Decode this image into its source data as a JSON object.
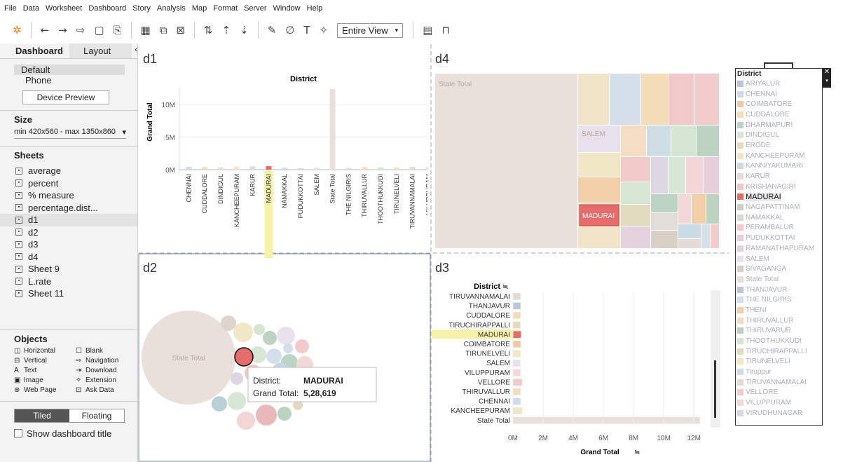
{
  "menu": [
    "File",
    "Data",
    "Worksheet",
    "Dashboard",
    "Story",
    "Analysis",
    "Map",
    "Format",
    "Server",
    "Window",
    "Help"
  ],
  "toolbar": {
    "view_select": "Entire View"
  },
  "left_pane": {
    "tabs": [
      "Dashboard",
      "Layout"
    ],
    "devices": [
      "Default",
      "Phone"
    ],
    "device_preview": "Device Preview",
    "size_title": "Size",
    "size_value": "min 420x560 - max 1350x860",
    "sheets_title": "Sheets",
    "sheets": [
      "average",
      "percent",
      "% measure",
      "percentage.dist...",
      "d1",
      "d2",
      "d3",
      "d4",
      "Sheet 9",
      "L.rate",
      "Sheet 11"
    ],
    "objects_title": "Objects",
    "objects": [
      "Horizontal",
      "Blank",
      "Vertical",
      "Navigation",
      "Text",
      "Download",
      "Image",
      "Extension",
      "Web Page",
      "Ask Data"
    ],
    "tiled": "Tiled",
    "floating": "Floating",
    "show_title": "Show dashboard title"
  },
  "d1": {
    "title": "d1",
    "chart_title": "District",
    "ylabel": "Grand Total",
    "yticks": [
      "10M",
      "5M",
      "0M"
    ]
  },
  "d2": {
    "title": "d2",
    "state_label": "State Total",
    "tooltip_district_label": "District:",
    "tooltip_district_value": "MADURAI",
    "tooltip_total_label": "Grand Total:",
    "tooltip_total_value": "5,28,619"
  },
  "d3": {
    "title": "d3",
    "header": "District",
    "xlabel": "Grand Total",
    "xticks": [
      "0M",
      "2M",
      "4M",
      "6M",
      "8M",
      "10M",
      "12M"
    ]
  },
  "d4": {
    "title": "d4",
    "state_label": "State Total",
    "salem_label": "SALEM",
    "madurai_label": "MADURAI"
  },
  "legend": {
    "title": "District",
    "items": [
      "ARIYALUR",
      "CHENNAI",
      "COIMBATORE",
      "CUDDALORE",
      "DHARMAPURI",
      "DINDIGUL",
      "ERODE",
      "KANCHEEPURAM",
      "KANNIYAKUMARI",
      "KARUR",
      "KRISHANAGIRI",
      "MADURAI",
      "NAGAPATTINAM",
      "NAMAKKAL",
      "PERAMBALUR",
      "PUDUKKOTTAI",
      "RAMANATHAPURAM",
      "SALEM",
      "SIVAGANGA",
      "State Total",
      "THANJAVUR",
      "THE NILGIRIS",
      "THENI",
      "THIRUVALLUR",
      "THIRUVARUR",
      "THOOTHUKKUDI",
      "TIRUCHIRAPPALLI",
      "TIRUNELVELI",
      "Tiruppur",
      "TIRUVANNAMALAI",
      "VELLORE",
      "VILUPPURAM",
      "VIRUDHUNAGAR"
    ],
    "colors": [
      "#b9c7d6",
      "#cfdbe8",
      "#f2c7a6",
      "#f4dcb8",
      "#bcd4c4",
      "#d7e6d5",
      "#e6dcc0",
      "#f2e4c8",
      "#cbdbe3",
      "#e2ddd9",
      "#f1c9c9",
      "#e66b6b",
      "#cbd1c9",
      "#d9d9d9",
      "#f5c9c9",
      "#e6cfd8",
      "#e4d2de",
      "#e8e0ea",
      "#d8cfc5",
      "#eae0db",
      "#b8c8d8",
      "#d5dfe9",
      "#f3cfa9",
      "#f4ddc2",
      "#bcd3c1",
      "#d6e5d3",
      "#e3dbbf",
      "#f1e6c6",
      "#cfdde4",
      "#e3dcd4",
      "#f2cccc",
      "#f4d8d8",
      "#ddd6e3"
    ],
    "highlight": "MADURAI"
  },
  "chart_data": [
    {
      "type": "bar",
      "title": "District",
      "ylabel": "Grand Total",
      "categories": [
        "CHENNAI",
        "CUDDALORE",
        "DINDIGUL",
        "KANCHEEPURAM",
        "KARUR",
        "MADURAI",
        "NAMAKKAL",
        "PUDUKKOTTAI",
        "SALEM",
        "State Total",
        "THE NILGIRIS",
        "THIRUVALLUR",
        "THOOTHUKKUDI",
        "TIRUNELVELI",
        "TIRUVANNAMALAI",
        "VILUPPURAM"
      ],
      "values": [
        0.45,
        0.4,
        0.35,
        0.45,
        0.5,
        0.53,
        0.3,
        0.2,
        0.3,
        12.4,
        0.25,
        0.4,
        0.35,
        0.35,
        0.45,
        0.4
      ],
      "units": "M",
      "ylim": [
        0,
        12.5
      ],
      "highlight": "MADURAI"
    },
    {
      "type": "bar",
      "orientation": "horizontal",
      "xlabel": "Grand Total",
      "categories": [
        "TIRUVANNAMALAI",
        "THANJAVUR",
        "CUDDALORE",
        "TIRUCHIRAPPALLI",
        "MADURAI",
        "COIMBATORE",
        "TIRUNELVELI",
        "SALEM",
        "VILUPPURAM",
        "VELLORE",
        "THIRUVALLUR",
        "CHENNAI",
        "KANCHEEPURAM",
        "State Total"
      ],
      "values": [
        0.5,
        0.5,
        0.5,
        0.5,
        0.53,
        0.5,
        0.5,
        0.5,
        0.5,
        0.6,
        0.5,
        0.5,
        0.6,
        12.4
      ],
      "units": "M",
      "xlim": [
        0,
        12.5
      ],
      "highlight": "MADURAI"
    }
  ]
}
